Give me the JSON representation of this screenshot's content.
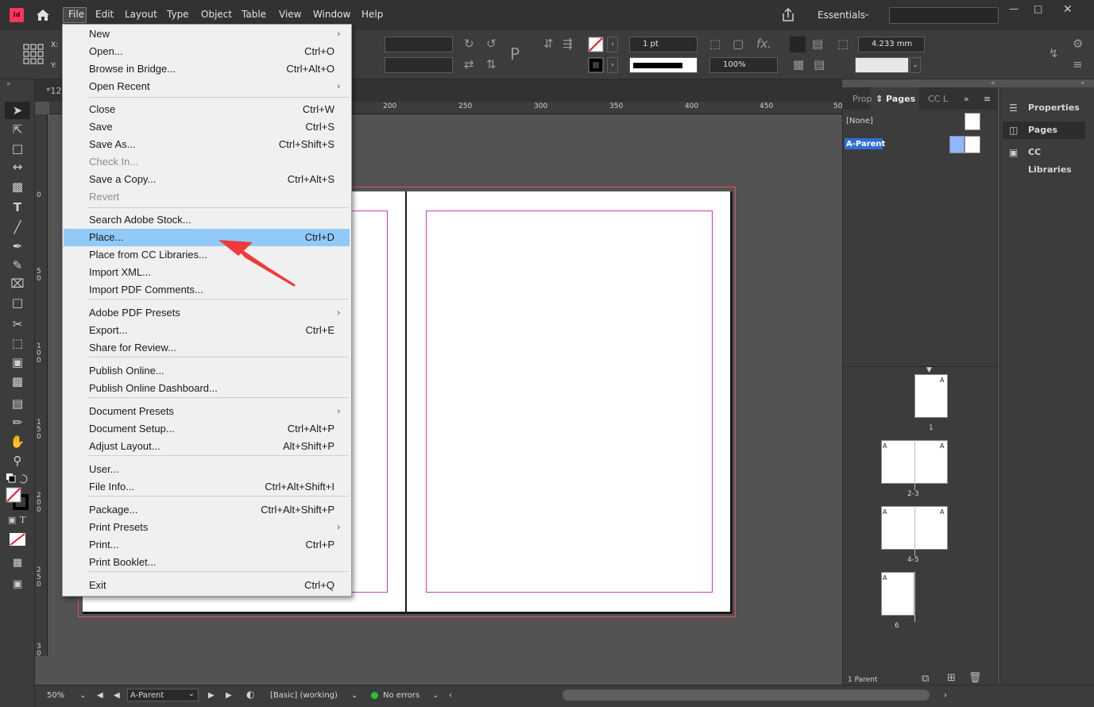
{
  "app": {
    "logo": "Id",
    "doc_tab": "*12"
  },
  "menubar": {
    "items": [
      "File",
      "Edit",
      "Layout",
      "Type",
      "Object",
      "Table",
      "View",
      "Window",
      "Help"
    ],
    "workspace": "Essentials"
  },
  "controlbar": {
    "x_label": "X:",
    "y_label": "Y:",
    "stroke_weight": "1 pt",
    "scale": "100%",
    "gutter": "4.233 mm"
  },
  "file_menu": {
    "items": [
      {
        "label": "New",
        "shortcut": "",
        "submenu": true,
        "enabled": true
      },
      {
        "label": "Open...",
        "shortcut": "Ctrl+O",
        "submenu": false,
        "enabled": true
      },
      {
        "label": "Browse in Bridge...",
        "shortcut": "Ctrl+Alt+O",
        "submenu": false,
        "enabled": true
      },
      {
        "label": "Open Recent",
        "shortcut": "",
        "submenu": true,
        "enabled": true
      },
      {
        "label": "Close",
        "shortcut": "Ctrl+W",
        "submenu": false,
        "enabled": true
      },
      {
        "label": "Save",
        "shortcut": "Ctrl+S",
        "submenu": false,
        "enabled": true
      },
      {
        "label": "Save As...",
        "shortcut": "Ctrl+Shift+S",
        "submenu": false,
        "enabled": true
      },
      {
        "label": "Check In...",
        "shortcut": "",
        "submenu": false,
        "enabled": false
      },
      {
        "label": "Save a Copy...",
        "shortcut": "Ctrl+Alt+S",
        "submenu": false,
        "enabled": true
      },
      {
        "label": "Revert",
        "shortcut": "",
        "submenu": false,
        "enabled": false
      },
      {
        "label": "Search Adobe Stock...",
        "shortcut": "",
        "submenu": false,
        "enabled": true
      },
      {
        "label": "Place...",
        "shortcut": "Ctrl+D",
        "submenu": false,
        "enabled": true,
        "highlighted": true
      },
      {
        "label": "Place from CC Libraries...",
        "shortcut": "",
        "submenu": false,
        "enabled": true
      },
      {
        "label": "Import XML...",
        "shortcut": "",
        "submenu": false,
        "enabled": true
      },
      {
        "label": "Import PDF Comments...",
        "shortcut": "",
        "submenu": false,
        "enabled": true
      },
      {
        "label": "Adobe PDF Presets",
        "shortcut": "",
        "submenu": true,
        "enabled": true
      },
      {
        "label": "Export...",
        "shortcut": "Ctrl+E",
        "submenu": false,
        "enabled": true
      },
      {
        "label": "Share for Review...",
        "shortcut": "",
        "submenu": false,
        "enabled": true
      },
      {
        "label": "Publish Online...",
        "shortcut": "",
        "submenu": false,
        "enabled": true
      },
      {
        "label": "Publish Online Dashboard...",
        "shortcut": "",
        "submenu": false,
        "enabled": true
      },
      {
        "label": "Document Presets",
        "shortcut": "",
        "submenu": true,
        "enabled": true
      },
      {
        "label": "Document Setup...",
        "shortcut": "Ctrl+Alt+P",
        "submenu": false,
        "enabled": true
      },
      {
        "label": "Adjust Layout...",
        "shortcut": "Alt+Shift+P",
        "submenu": false,
        "enabled": true
      },
      {
        "label": "User...",
        "shortcut": "",
        "submenu": false,
        "enabled": true
      },
      {
        "label": "File Info...",
        "shortcut": "Ctrl+Alt+Shift+I",
        "submenu": false,
        "enabled": true
      },
      {
        "label": "Package...",
        "shortcut": "Ctrl+Alt+Shift+P",
        "submenu": false,
        "enabled": true
      },
      {
        "label": "Print Presets",
        "shortcut": "",
        "submenu": true,
        "enabled": true
      },
      {
        "label": "Print...",
        "shortcut": "Ctrl+P",
        "submenu": false,
        "enabled": true
      },
      {
        "label": "Print Booklet...",
        "shortcut": "",
        "submenu": false,
        "enabled": true
      },
      {
        "label": "Exit",
        "shortcut": "Ctrl+Q",
        "submenu": false,
        "enabled": true
      }
    ]
  },
  "ruler": {
    "h_ticks": [
      "200",
      "250",
      "300",
      "350",
      "400",
      "450",
      "50"
    ],
    "v_ticks": [
      "0",
      "50",
      "100",
      "150",
      "200",
      "250",
      "30"
    ]
  },
  "pages_panel": {
    "tabs": [
      "Prop",
      "Pages",
      "CC L"
    ],
    "parents": [
      "[None]",
      "A-Parent"
    ],
    "parent_marker": "A",
    "page_labels": [
      "1",
      "2-3",
      "4-5",
      "6"
    ],
    "footer": "1 Parent"
  },
  "right_dock": {
    "items": [
      "Properties",
      "Pages",
      "CC Libraries"
    ]
  },
  "statusbar": {
    "zoom": "50%",
    "page": "A-Parent",
    "preflight_profile": "[Basic] (working)",
    "errors": "No errors"
  },
  "colors": {
    "app_bg": "#535353",
    "menu_highlight": "#91c9f7",
    "margin_guide": "#c63ac9",
    "bleed_guide": "#e0525e",
    "annotation_arrow": "#f0393b",
    "parent_highlight": "#2d6fd6",
    "status_ok": "#2ec12e"
  }
}
